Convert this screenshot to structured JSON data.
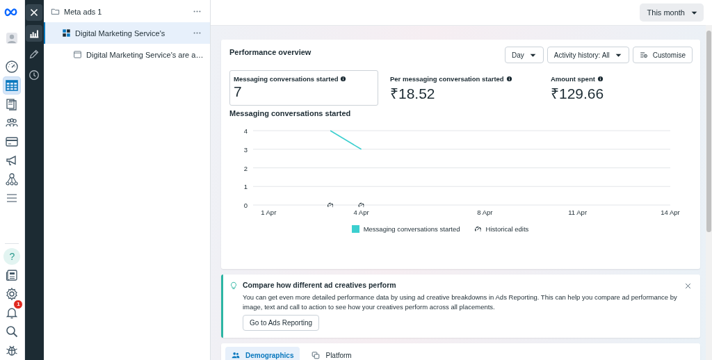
{
  "rail": {
    "top": [
      {
        "kind": "logo"
      },
      {
        "kind": "avatar",
        "selected": false
      },
      {
        "kind": "gauge",
        "selected": false
      },
      {
        "kind": "table",
        "selected": true
      },
      {
        "kind": "pages",
        "selected": false
      },
      {
        "kind": "people",
        "selected": false
      },
      {
        "kind": "card",
        "selected": false
      },
      {
        "kind": "megaphone",
        "selected": false
      },
      {
        "kind": "network",
        "selected": false
      },
      {
        "kind": "menu",
        "selected": false
      }
    ],
    "bottom": [
      {
        "kind": "help",
        "label": "?"
      },
      {
        "kind": "news"
      },
      {
        "kind": "gear"
      },
      {
        "kind": "bell",
        "badge": "1"
      },
      {
        "kind": "search"
      },
      {
        "kind": "bug"
      }
    ]
  },
  "strip": [
    {
      "kind": "close"
    },
    {
      "kind": "chart",
      "selected": true
    },
    {
      "kind": "pencil",
      "selected": false
    },
    {
      "kind": "clock",
      "selected": false
    }
  ],
  "tree": [
    {
      "label": "Meta ads 1",
      "kind": "folder",
      "selected": false,
      "children": [
        {
          "label": "Digital Marketing Service's",
          "kind": "campaign",
          "selected": true,
          "children": [
            {
              "label": "Digital Marketing Service's are a…",
              "kind": "ad",
              "selected": false
            }
          ]
        }
      ]
    }
  ],
  "date_range": {
    "label": "This month"
  },
  "performance": {
    "title": "Performance overview",
    "controls": [
      {
        "label": "Day",
        "kind": "dropdown"
      },
      {
        "label": "Activity history: All",
        "kind": "dropdown"
      },
      {
        "label": "Customise",
        "kind": "customise"
      }
    ],
    "metrics": [
      {
        "label": "Messaging conversations started",
        "value": "7",
        "selected": true
      },
      {
        "label": "Per messaging conversation started",
        "value": "₹18.52",
        "selected": false
      },
      {
        "label": "Amount spent",
        "value": "₹129.66",
        "selected": false
      }
    ],
    "chart_title": "Messaging conversations started",
    "chart_data": {
      "type": "line",
      "categories": [
        "1 Apr",
        null,
        null,
        "4 Apr",
        null,
        null,
        null,
        "8 Apr",
        null,
        null,
        "11 Apr",
        null,
        null,
        "14 Apr"
      ],
      "ylim": [
        0,
        4
      ],
      "yticks": [
        0,
        1,
        2,
        3,
        4
      ],
      "series": [
        {
          "name": "Messaging conversations started",
          "color": "#3ccfcf",
          "values": [
            null,
            null,
            4,
            3,
            null,
            null,
            null,
            null,
            null,
            null,
            null,
            null,
            null,
            null
          ]
        }
      ],
      "grid": true
    },
    "legend": [
      {
        "kind": "series"
      },
      {
        "label": "Historical edits",
        "kind": "edit"
      }
    ]
  },
  "tip": {
    "title": "Compare how different ad creatives perform",
    "body": "You can get even more detailed performance data by using ad creative breakdowns in Ads Reporting. This can help you compare ad performance by image, text and call to action to see how your creatives perform across all placements.",
    "button": "Go to Ads Reporting",
    "closable": true
  },
  "breakdown_tabs": [
    {
      "label": "Demographics",
      "kind": "people",
      "selected": true
    },
    {
      "label": "Platform",
      "kind": "platform",
      "selected": false
    }
  ]
}
